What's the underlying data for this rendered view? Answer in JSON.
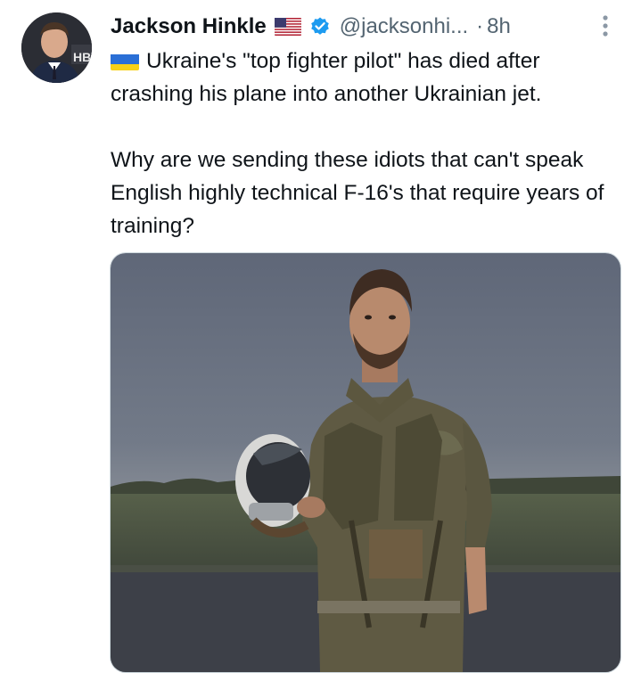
{
  "author": {
    "name": "Jackson Hinkle",
    "handle": "@jacksonhi...",
    "separator": "·",
    "time": "8h",
    "avatar_text": "HB",
    "flag_icon": "us-flag-icon",
    "verified_icon": "verified-badge-icon"
  },
  "tweet": {
    "paragraph1": "Ukraine's \"top fighter pilot\" has died after crashing his plane into another Ukrainian jet.",
    "paragraph2": "Why are we sending these idiots that can't speak English highly technical F-16's that require years of training?",
    "inline_flag_icon": "ukraine-flag-icon"
  },
  "media": {
    "type": "photo"
  },
  "colors": {
    "text": "#0f1419",
    "secondary": "#536471",
    "verified": "#1d9bf0",
    "ua_blue": "#2a6fd6",
    "ua_yellow": "#f7d117"
  }
}
